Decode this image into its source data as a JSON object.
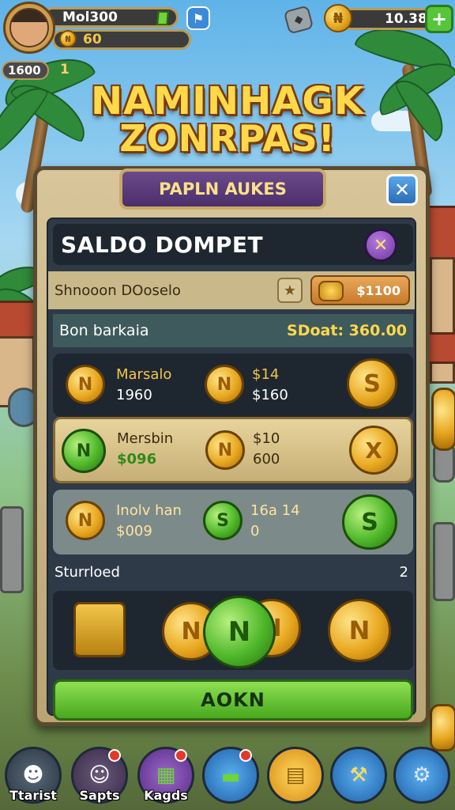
{
  "hud": {
    "player_name": "Mol300",
    "player_coins": "60",
    "level_badge": "1600",
    "level_extra": "1",
    "coin_balance": "10.38"
  },
  "title": {
    "line1": "NAMINHAGK",
    "line2": "ZONRPAS!"
  },
  "panel": {
    "header": "PAPLN AUKES",
    "wallet_title": "SALDO DOMPET",
    "sub_label": "Shnooon DOoselo",
    "sub_price": "$1100",
    "section_left": "Bon barkaia",
    "section_right": "SDoat: 360.00",
    "rows": [
      {
        "name": "Marsalo",
        "amount": "1960",
        "price_top": "$14",
        "price_bottom": "$160",
        "coin_letter": "N",
        "mid_letter": "N",
        "right_letter": "S"
      },
      {
        "name": "Mersbin",
        "amount": "$096",
        "price_top": "$10",
        "price_bottom": "600",
        "coin_letter": "N",
        "mid_letter": "N",
        "right_letter": "X"
      },
      {
        "name": "Inolv han",
        "amount": "$009",
        "price_top": "16a 14",
        "price_bottom": "0",
        "coin_letter": "N",
        "mid_letter": "S",
        "right_letter": "S"
      }
    ],
    "footer_label": "Sturrloed",
    "footer_count": "2",
    "cta_label": "AOKN"
  },
  "nav": [
    {
      "label": "Ttarist"
    },
    {
      "label": "Sapts"
    },
    {
      "label": "Kagds"
    },
    {
      "label": ""
    },
    {
      "label": ""
    },
    {
      "label": ""
    },
    {
      "label": ""
    }
  ],
  "colors": {
    "accent_gold": "#ffd94a",
    "panel_dark": "#2f3a48",
    "cta_green": "#49a81e",
    "header_purple": "#4b2f6a"
  }
}
